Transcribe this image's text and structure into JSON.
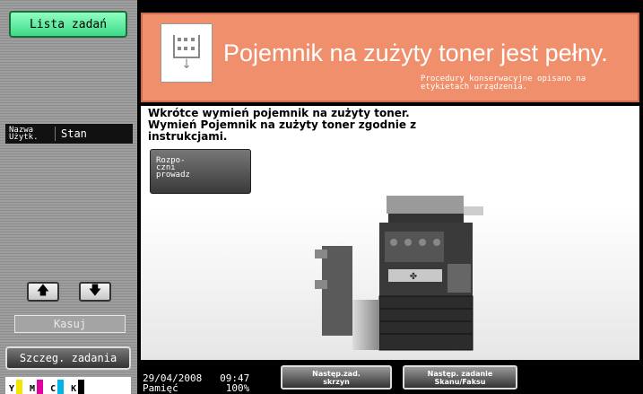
{
  "sidebar": {
    "job_list_label": "Lista zadań",
    "col_user": "Nazwa Użytk.",
    "col_status": "Stan",
    "up_icon": "up-arrow-icon",
    "down_icon": "down-arrow-icon",
    "delete_label": "Kasuj",
    "details_label": "Szczeg. zadania",
    "toners": [
      {
        "label": "Y",
        "color": "#f0e600"
      },
      {
        "label": "M",
        "color": "#e000a0"
      },
      {
        "label": "C",
        "color": "#00b4e6"
      },
      {
        "label": "K",
        "color": "#000000"
      }
    ]
  },
  "alert": {
    "icon": "waste-toner-box-icon",
    "title": "Pojemnik na zużyty toner jest pełny.",
    "subtitle": "Procedury konserwacyjne opisano na etykietach urządzenia.",
    "bg_color": "#f08f6c"
  },
  "content": {
    "message": "Wkrótce wymień pojemnik na zużyty toner. Wymień Pojemnik na zużyty toner zgodnie z instrukcjami.",
    "start_label": "Rozpo-\nczni\nprowadz"
  },
  "status_bar": {
    "date": "29/04/2008",
    "time": "09:47",
    "memory_label": "Pamięć",
    "memory_value": "100%",
    "next_job_label": "Następ.zad.\nskrzyn",
    "next_scan_label": "Następ. zadanie\nSkanu/Faksu"
  }
}
